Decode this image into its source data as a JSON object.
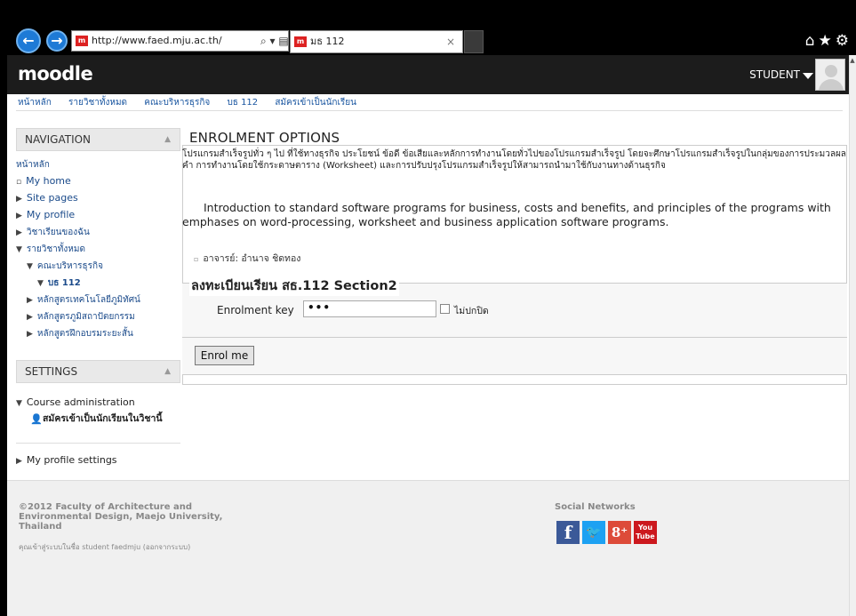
{
  "browser": {
    "address": "http://www.faed.mju.ac.th/",
    "address_tools": "⌕ ▾ ▤ ↻ ✕",
    "tab_title": "มธ 112",
    "tab_close": "×",
    "favicon": "m"
  },
  "header": {
    "logo": "moodle",
    "user": "STUDENT"
  },
  "breadcrumb": [
    "หน้าหลัก",
    "รายวิชาทั้งหมด",
    "คณะบริหารธุรกิจ",
    "บธ 112",
    "สมัครเข้าเป็นนักเรียน"
  ],
  "navigation": {
    "title": "NAVIGATION",
    "items": [
      {
        "label": "หน้าหลัก",
        "marker": ""
      },
      {
        "label": "My home",
        "marker": "▫"
      },
      {
        "label": "Site pages",
        "marker": "▶"
      },
      {
        "label": "My profile",
        "marker": "▶"
      },
      {
        "label": "วิชาเรียนของฉัน",
        "marker": "▶"
      },
      {
        "label": "รายวิชาทั้งหมด",
        "marker": "▼"
      },
      {
        "label": "คณะบริหารธุรกิจ",
        "marker": "▼"
      },
      {
        "label": "บธ 112",
        "marker": "▼"
      },
      {
        "label": "หลักสูตรเทคโนโลยีภูมิทัศน์",
        "marker": "▶"
      },
      {
        "label": "หลักสูตรภูมิสถาปัตยกรรม",
        "marker": "▶"
      },
      {
        "label": "หลักสูตรฝึกอบรมระยะสั้น",
        "marker": "▶"
      }
    ]
  },
  "settings": {
    "title": "SETTINGS",
    "course_admin": "Course administration",
    "enrol_link": "สมัครเข้าเป็นนักเรียนในวิชานี้",
    "profile_settings": "My profile settings"
  },
  "main": {
    "title": "ENROLMENT OPTIONS",
    "thai_summary": "โปรแกรมสำเร็จรูปทั่ว ๆ ไป ที่ใช้ทางธุรกิจ ประโยชน์ ข้อดี ข้อเสียและหลักการทำงานโดยทั่วไปของโปรแกรมสำเร็จรูป โดยจะศึกษาโปรแกรมสำเร็จรูปในกลุ่มของการประมวลผลคำ การทำงานโดยใช้กระดาษตาราง (Worksheet) และการปรับปรุงโปรแกรมสำเร็จรูปให้สามารถนำมาใช้กับงานทางด้านธุรกิจ",
    "english_summary": "Introduction to standard software programs for business, costs and benefits, and principles of the programs with emphases on word-processing, worksheet and business application software programs.",
    "teacher": "อาจารย์: อำนาจ ชิดทอง",
    "section_title": "ลงทะเบียนเรียน สธ.112 Section2",
    "key_label": "Enrolment key",
    "key_value": "•••",
    "unmask_label": "ไม่ปกปิด",
    "enrol_button": "Enrol me"
  },
  "footer": {
    "copyright": "©2012 Faculty of Architecture and Environmental Design, Maejo University, Thailand",
    "login_info": "คุณเข้าสู่ระบบในชื่อ student faedmju (ออกจากระบบ)",
    "social_title": "Social Networks",
    "social": [
      {
        "name": "facebook",
        "glyph": "f",
        "color": "#3b5998"
      },
      {
        "name": "twitter",
        "glyph": "🐦",
        "color": "#1da1f2"
      },
      {
        "name": "googleplus",
        "glyph": "8⁺",
        "color": "#dd4b39"
      },
      {
        "name": "youtube",
        "glyph": "You Tube",
        "color": "#cc181e"
      }
    ]
  }
}
